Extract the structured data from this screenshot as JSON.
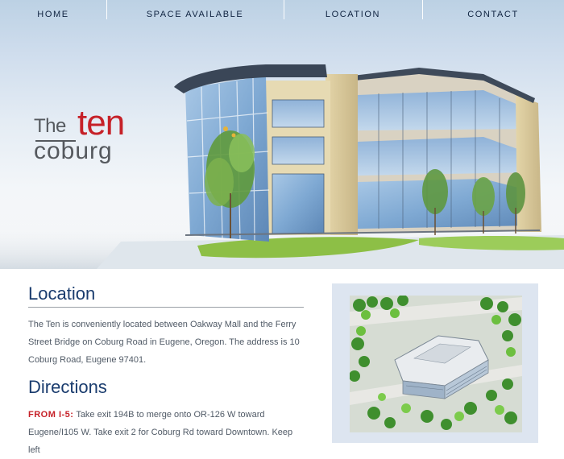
{
  "nav": {
    "items": [
      {
        "label": "HOME"
      },
      {
        "label": "SPACE AVAILABLE"
      },
      {
        "label": "LOCATION"
      },
      {
        "label": "CONTACT"
      }
    ]
  },
  "logo": {
    "the": "The",
    "ten": "ten",
    "coburg": "coburg"
  },
  "hero": {
    "image": "building-rendering"
  },
  "location": {
    "heading": "Location",
    "text": "The Ten is conveniently located between Oakway Mall and the Ferry Street Bridge on Coburg Road in Eugene, Oregon. The address is 10 Coburg Road, Eugene 97401."
  },
  "directions": {
    "heading": "Directions",
    "from_label": "FROM I-5:",
    "text": "Take exit 194B to merge onto OR-126 W toward Eugene/I105 W. Take exit 2 for Coburg Rd toward Downtown. Keep left"
  },
  "aerial": {
    "image": "aerial-site-rendering"
  },
  "colors": {
    "accent_red": "#c62128",
    "heading_blue": "#1a3c6e",
    "nav_text": "#0f2340",
    "body_text": "#505a66"
  }
}
